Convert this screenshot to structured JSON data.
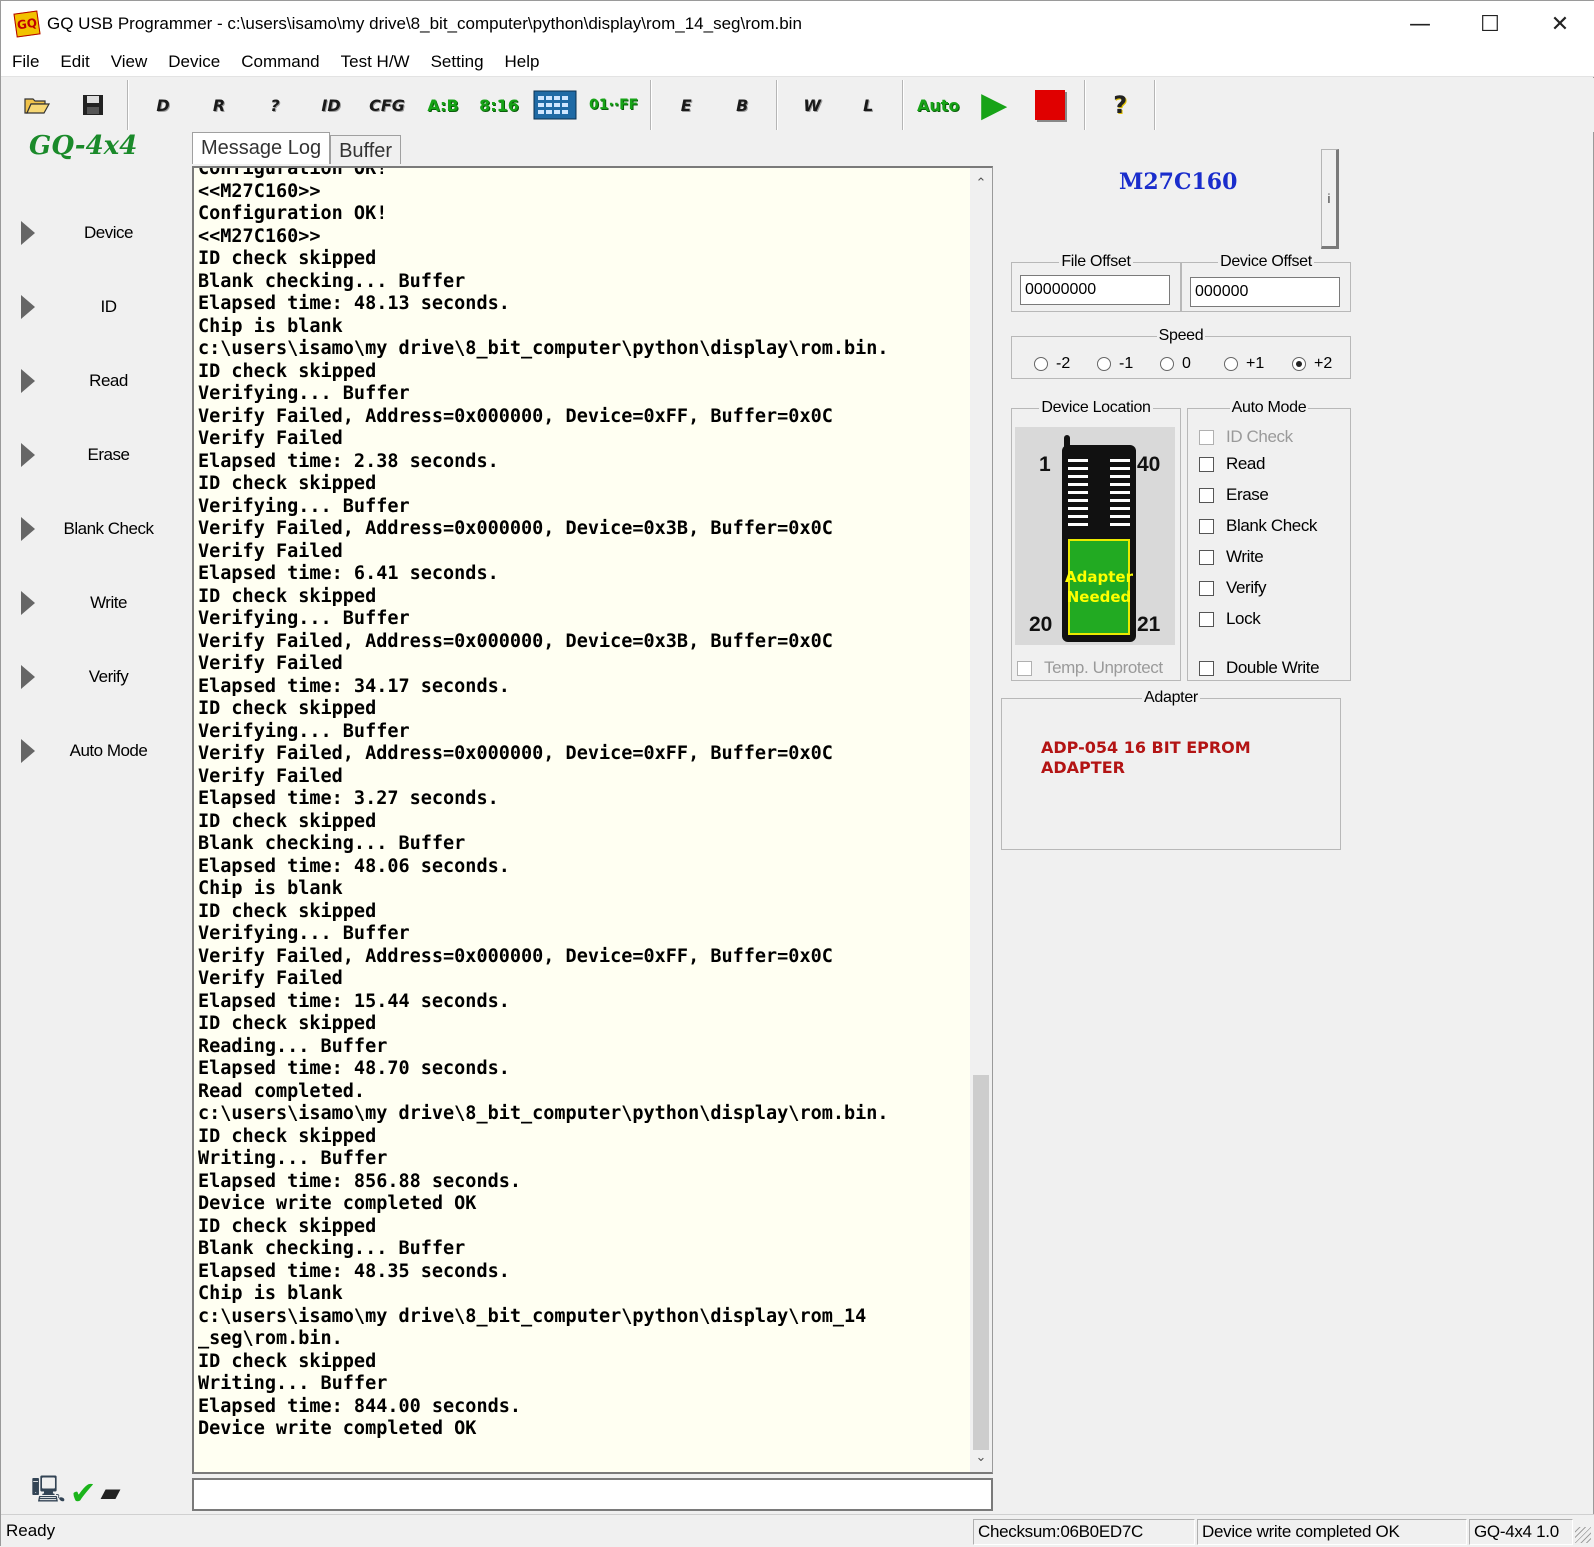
{
  "window": {
    "title": "GQ USB Programmer - c:\\users\\isamo\\my drive\\8_bit_computer\\python\\display\\rom_14_seg\\rom.bin",
    "icon_text": "GQ",
    "minimize_glyph": "—",
    "maximize_glyph": "☐",
    "close_glyph": "✕"
  },
  "menu": [
    "File",
    "Edit",
    "View",
    "Device",
    "Command",
    "Test H/W",
    "Setting",
    "Help"
  ],
  "toolbar": {
    "open_icon": "folder-open-icon",
    "save_icon": "floppy-disk-icon",
    "buttons": [
      {
        "name": "device-chip-button",
        "label": "D"
      },
      {
        "name": "read-chip-button",
        "label": "R"
      },
      {
        "name": "verify-chip-button",
        "label": "?"
      },
      {
        "name": "id-chip-button",
        "label": "ID"
      },
      {
        "name": "config-chip-button",
        "label": "CFG"
      },
      {
        "name": "swap-ab-button",
        "label": "A:B"
      },
      {
        "name": "split-8-16-button",
        "label": "8:16"
      },
      {
        "name": "hex-editor-button",
        "label": "▦"
      },
      {
        "name": "fill-ff-button",
        "label": "01··FF"
      },
      {
        "name": "erase-chip-button",
        "label": "E"
      },
      {
        "name": "blank-check-chip-button",
        "label": "B"
      },
      {
        "name": "write-chip-button",
        "label": "W"
      },
      {
        "name": "lock-chip-button",
        "label": "L"
      },
      {
        "name": "auto-button",
        "label": "Auto"
      }
    ],
    "play_glyph": "▶",
    "help_glyph": "?"
  },
  "brand": "GQ-4x4",
  "sidebar": {
    "items": [
      "Device",
      "ID",
      "Read",
      "Erase",
      "Blank Check",
      "Write",
      "Verify",
      "Auto Mode"
    ]
  },
  "tabs": [
    "Message Log",
    "Buffer"
  ],
  "log": "Configuration OK!\n<<M27C160>>\nConfiguration OK!\n<<M27C160>>\nID check skipped\nBlank checking... Buffer\nElapsed time: 48.13 seconds.\nChip is blank\nc:\\users\\isamo\\my drive\\8_bit_computer\\python\\display\\rom.bin.\nID check skipped\nVerifying... Buffer\nVerify Failed, Address=0x000000, Device=0xFF, Buffer=0x0C\nVerify Failed\nElapsed time: 2.38 seconds.\nID check skipped\nVerifying... Buffer\nVerify Failed, Address=0x000000, Device=0x3B, Buffer=0x0C\nVerify Failed\nElapsed time: 6.41 seconds.\nID check skipped\nVerifying... Buffer\nVerify Failed, Address=0x000000, Device=0x3B, Buffer=0x0C\nVerify Failed\nElapsed time: 34.17 seconds.\nID check skipped\nVerifying... Buffer\nVerify Failed, Address=0x000000, Device=0xFF, Buffer=0x0C\nVerify Failed\nElapsed time: 3.27 seconds.\nID check skipped\nBlank checking... Buffer\nElapsed time: 48.06 seconds.\nChip is blank\nID check skipped\nVerifying... Buffer\nVerify Failed, Address=0x000000, Device=0xFF, Buffer=0x0C\nVerify Failed\nElapsed time: 15.44 seconds.\nID check skipped\nReading... Buffer\nElapsed time: 48.70 seconds.\nRead completed.\nc:\\users\\isamo\\my drive\\8_bit_computer\\python\\display\\rom.bin.\nID check skipped\nWriting... Buffer\nElapsed time: 856.88 seconds.\nDevice write completed OK\nID check skipped\nBlank checking... Buffer\nElapsed time: 48.35 seconds.\nChip is blank\nc:\\users\\isamo\\my drive\\8_bit_computer\\python\\display\\rom_14\n_seg\\rom.bin.\nID check skipped\nWriting... Buffer\nElapsed time: 844.00 seconds.\nDevice write completed OK",
  "scrollbar": {
    "up": "⌃",
    "down": "⌄"
  },
  "device": {
    "name": "M27C160",
    "info_label": "i"
  },
  "offsets": {
    "file_offset_label": "File Offset",
    "file_offset_value": "00000000",
    "device_offset_label": "Device Offset",
    "device_offset_value": "000000"
  },
  "speed": {
    "label": "Speed",
    "options": [
      "-2",
      "-1",
      "0",
      "+1",
      "+2"
    ],
    "selected": "+2"
  },
  "device_location": {
    "label": "Device Location",
    "pin_tl": "1",
    "pin_tr": "40",
    "pin_bl": "20",
    "pin_br": "21",
    "adapter_text": "Adapter\nNeeded",
    "temp_unprotect": "Temp. Unprotect"
  },
  "auto_mode": {
    "label": "Auto Mode",
    "options": [
      {
        "label": "ID Check",
        "enabled": false,
        "checked": false
      },
      {
        "label": "Read",
        "enabled": true,
        "checked": false
      },
      {
        "label": "Erase",
        "enabled": true,
        "checked": false
      },
      {
        "label": "Blank Check",
        "enabled": true,
        "checked": false
      },
      {
        "label": "Write",
        "enabled": true,
        "checked": false
      },
      {
        "label": "Verify",
        "enabled": true,
        "checked": false
      },
      {
        "label": "Lock",
        "enabled": true,
        "checked": false
      }
    ],
    "double_write": "Double Write"
  },
  "adapter": {
    "label": "Adapter",
    "name": "ADP-054 16 BIT EPROM\nADAPTER"
  },
  "status": {
    "ready": "Ready",
    "checksum": "Checksum:06B0ED7C",
    "message": "Device write completed OK",
    "version": "GQ-4x4 1.0"
  },
  "colors": {
    "device_name": "#1a2dcc",
    "adapter_name": "#b31414",
    "brand": "#1a8a2a",
    "log_bg": "#fffff2",
    "stop": "#e00000",
    "play": "#17a317"
  }
}
